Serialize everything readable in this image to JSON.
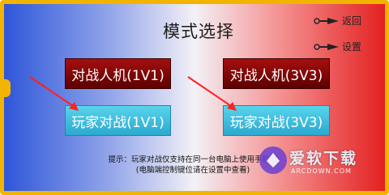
{
  "screen": {
    "title": "模式选择"
  },
  "top_buttons": {
    "back_label": "返回",
    "settings_label": "设置"
  },
  "modes": {
    "pve_1v1": "对战人机(1V1)",
    "pve_3v3": "对战人机(3V3)",
    "pvp_1v1": "玩家对战(1V1)",
    "pvp_3v3": "玩家对战(3V3)"
  },
  "tip": {
    "line1": "提示：玩家对战仅支持在同一台电脑上使用手机或",
    "line2": "(电脑端控制键位请在设置中查看)"
  },
  "watermark": {
    "brand": "爱软下载",
    "domain": "ARCDOWN.COM"
  },
  "colors": {
    "frame": "#f2b400",
    "pve_button": "#8a0808",
    "pvp_button": "#3fc0e0",
    "left_gradient": "#2e56d9",
    "right_gradient": "#e42020"
  },
  "icons": {
    "back": "kunai-icon",
    "settings": "kunai-icon",
    "pointer": "red-arrow-icon"
  }
}
